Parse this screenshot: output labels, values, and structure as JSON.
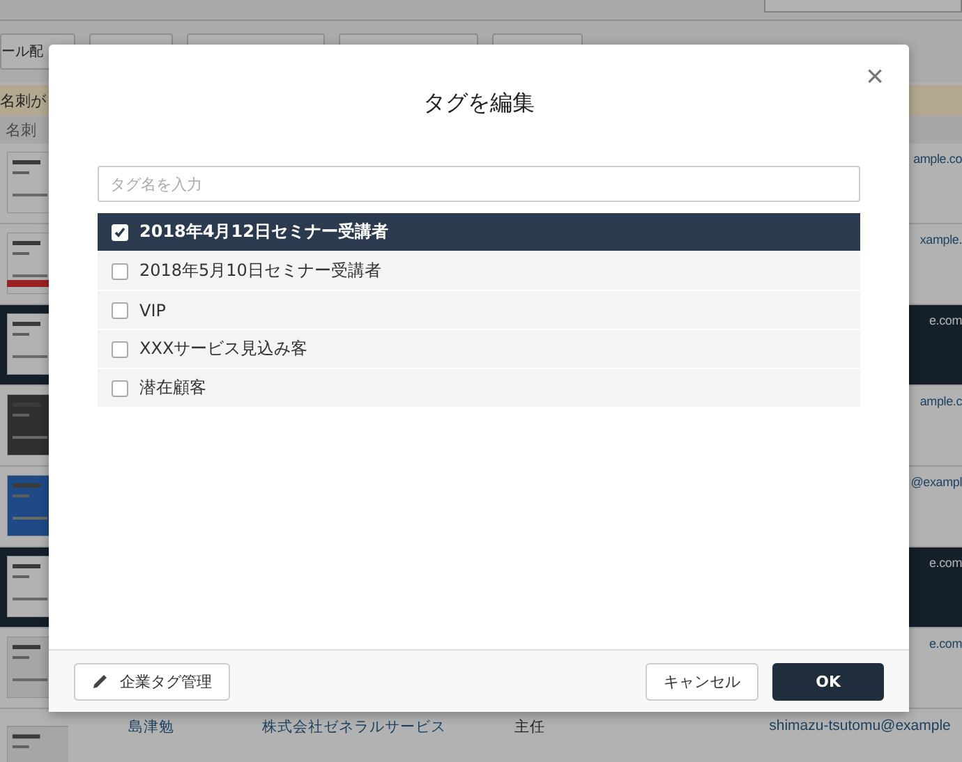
{
  "background": {
    "toolbar_tab": "ール配",
    "notice": "名刺が",
    "table_header": "名刺",
    "rows": [
      {
        "email": "ample.co",
        "selected": false
      },
      {
        "email": "xample.",
        "selected": false
      },
      {
        "email": "e.com",
        "selected": true
      },
      {
        "email": "ample.c",
        "selected": false
      },
      {
        "email": "@exampl",
        "selected": false
      },
      {
        "email": "e.com",
        "selected": true
      },
      {
        "email": "e.com",
        "selected": false
      }
    ],
    "last_row": {
      "name": "島津勉",
      "company": "株式会社ゼネラルサービス",
      "title": "主任",
      "email": "shimazu-tsutomu@example"
    }
  },
  "dialog": {
    "title": "タグを編集",
    "close": "×",
    "search": {
      "placeholder": "タグ名を入力"
    },
    "tags": [
      {
        "label": "2018年4月12日セミナー受講者",
        "checked": true
      },
      {
        "label": "2018年5月10日セミナー受講者",
        "checked": false
      },
      {
        "label": "VIP",
        "checked": false
      },
      {
        "label": "XXXサービス見込み客",
        "checked": false
      },
      {
        "label": "潜在顧客",
        "checked": false
      }
    ],
    "manage_button": "企業タグ管理",
    "cancel_button": "キャンセル",
    "ok_button": "OK"
  }
}
